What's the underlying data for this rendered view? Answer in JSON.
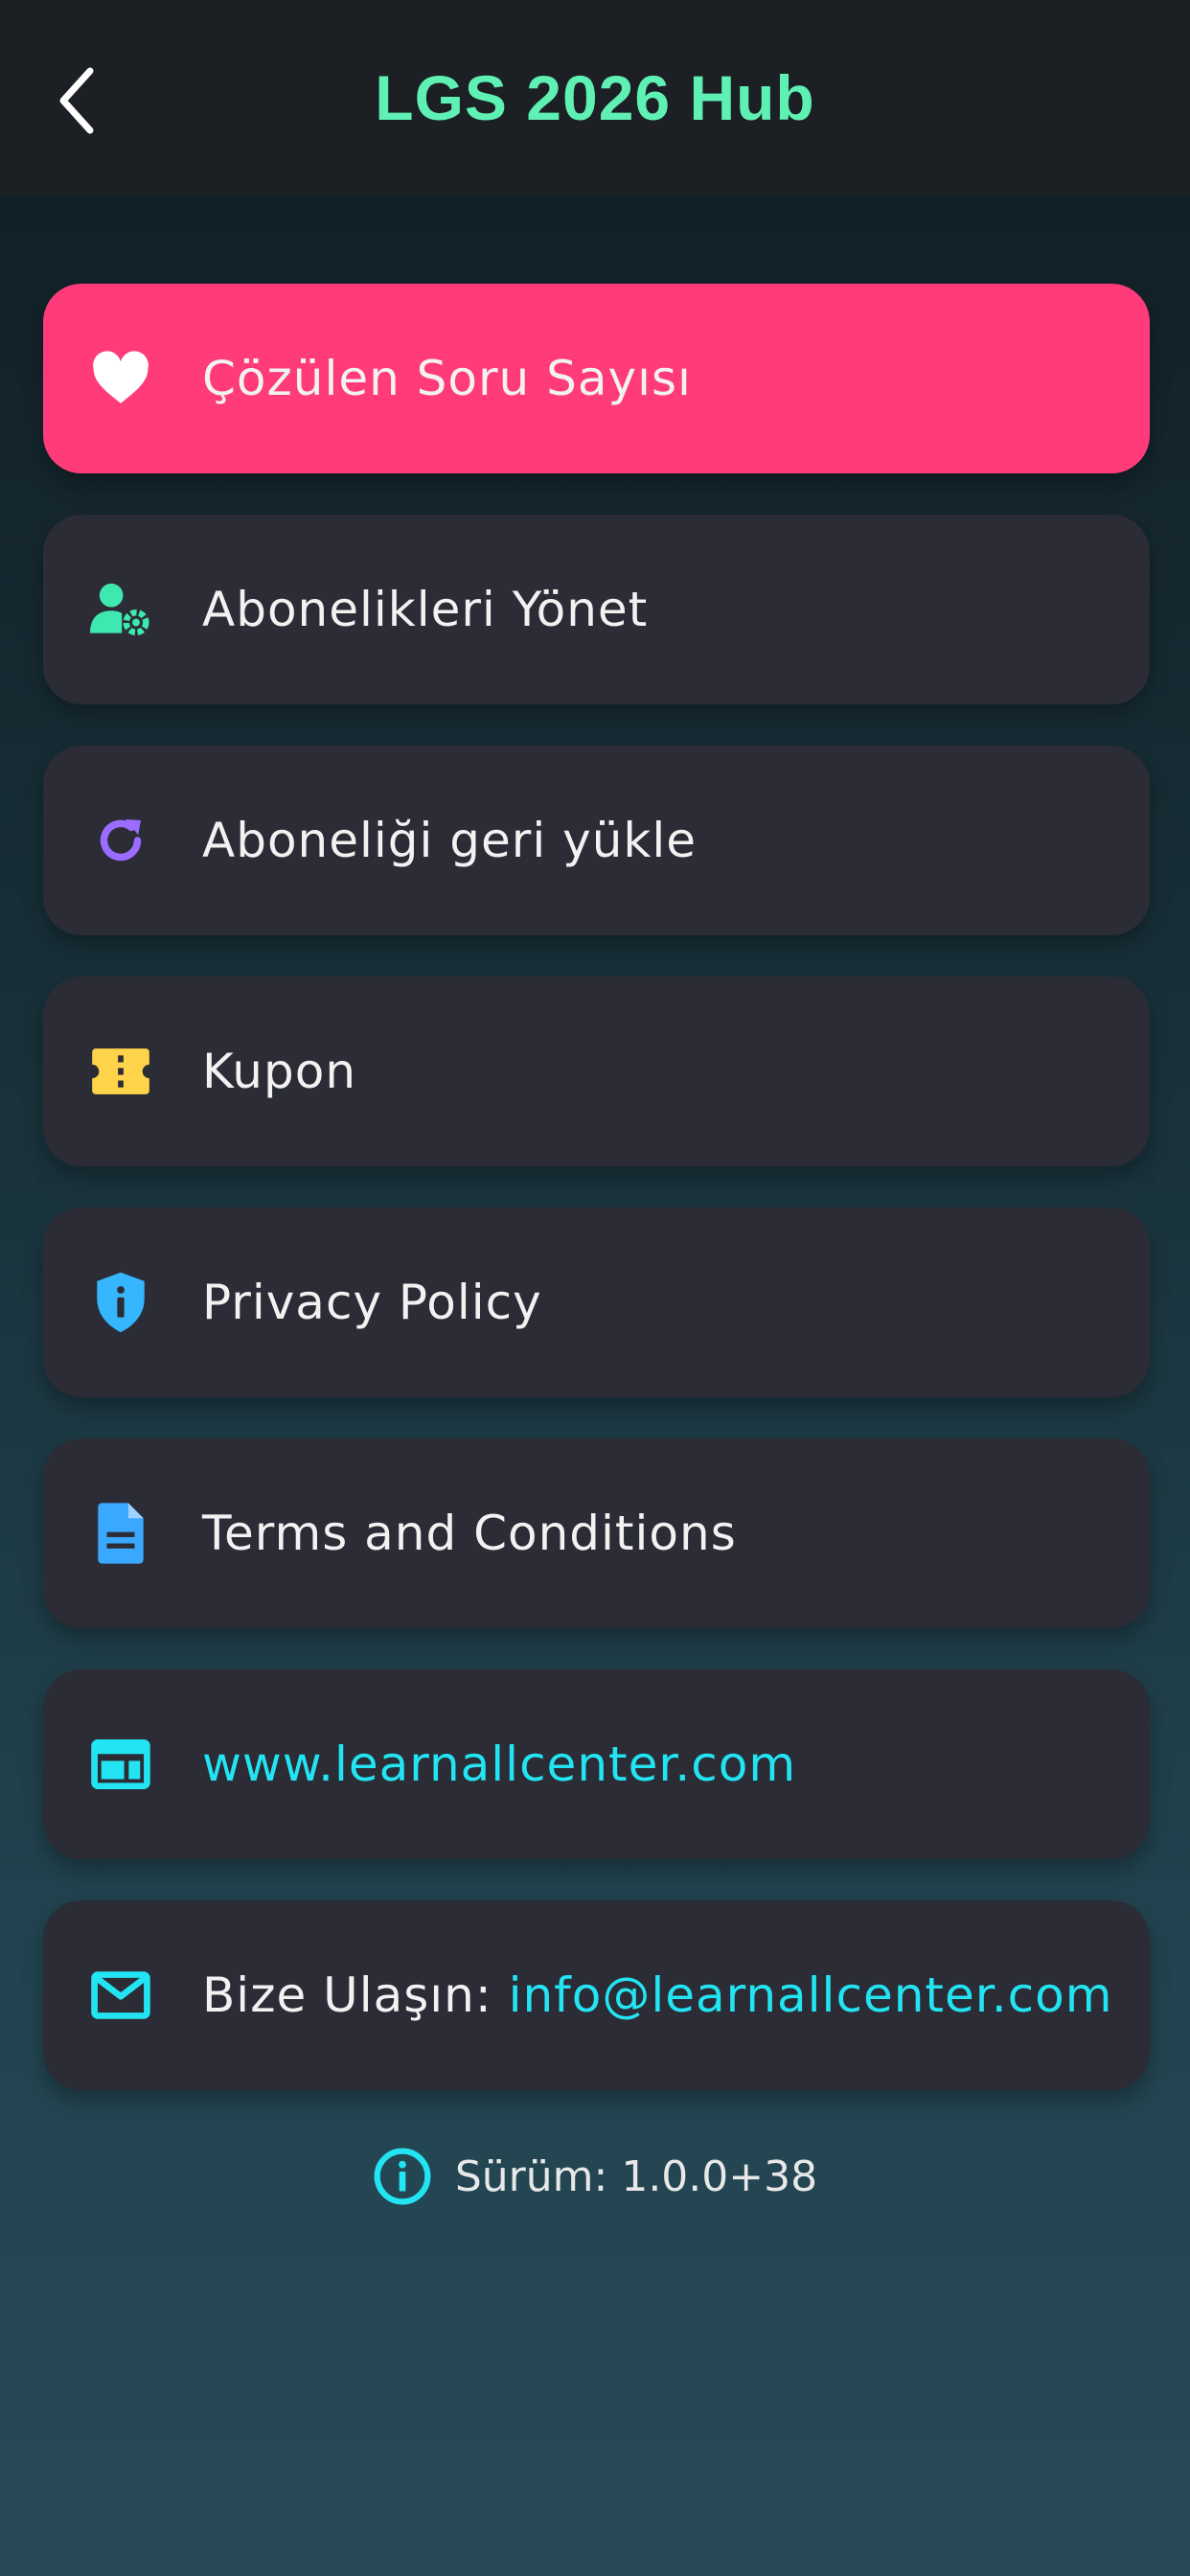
{
  "header": {
    "title": "LGS 2026 Hub",
    "back_icon": "chevron-left-icon"
  },
  "menu": {
    "items": [
      {
        "label": "Çözülen Soru Sayısı",
        "icon": "heart-icon",
        "color": "#ff3b7a",
        "active": true
      },
      {
        "label": "Abonelikleri Yönet",
        "icon": "user-settings-icon",
        "color": "#3ee8b0"
      },
      {
        "label": "Aboneliği geri yükle",
        "icon": "refresh-icon",
        "color": "#9b6cff"
      },
      {
        "label": "Kupon",
        "icon": "ticket-icon",
        "color": "#ffd34a"
      },
      {
        "label": "Privacy Policy",
        "icon": "shield-info-icon",
        "color": "#35b6ff"
      },
      {
        "label": "Terms and Conditions",
        "icon": "document-icon",
        "color": "#3aa8ff"
      },
      {
        "label": "www.learnallcenter.com",
        "icon": "web-icon",
        "color": "#23e4f2"
      },
      {
        "label": "Bize Ulaşın: ",
        "link": "info@learnallcenter.com",
        "icon": "mail-icon",
        "color": "#23e4f2"
      }
    ]
  },
  "version": {
    "text": "Sürüm: 1.0.0+38",
    "icon": "info-circle-icon",
    "color": "#23e4f2"
  }
}
